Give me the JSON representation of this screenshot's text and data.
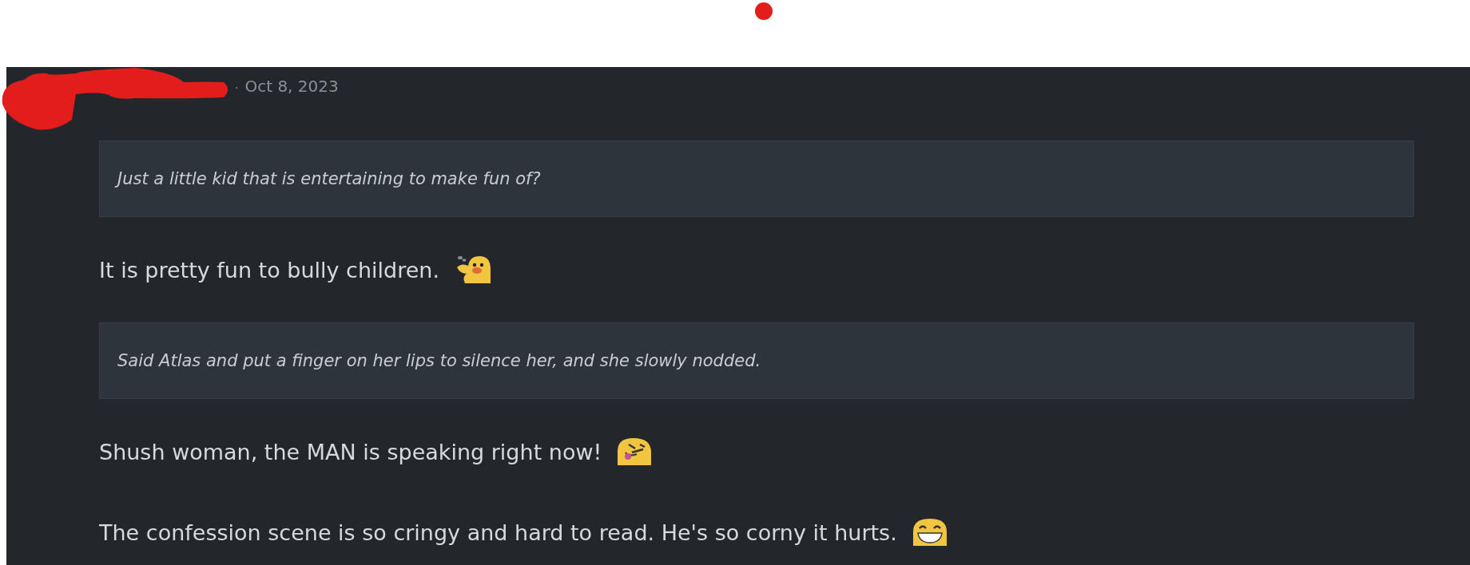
{
  "post": {
    "separator": "·",
    "date": "Oct 8, 2023",
    "blocks": [
      {
        "kind": "quote",
        "text": "Just a little kid that is entertaining to make fun of?"
      },
      {
        "kind": "paragraph",
        "text": "It is pretty fun to bully children."
      },
      {
        "kind": "quote",
        "text": "Said Atlas and put a finger on her lips to silence her, and she slowly nodded."
      },
      {
        "kind": "paragraph",
        "text": "Shush woman, the MAN is speaking right now!"
      },
      {
        "kind": "paragraph",
        "text": "The confession scene is so cringy and hard to read. He's so corny it hurts."
      }
    ]
  }
}
